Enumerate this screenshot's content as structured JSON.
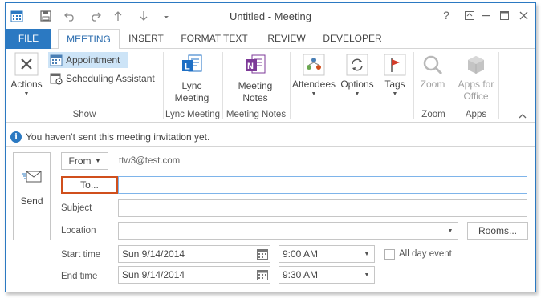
{
  "window": {
    "title": "Untitled - Meeting"
  },
  "tabs": [
    {
      "label": "FILE"
    },
    {
      "label": "MEETING"
    },
    {
      "label": "INSERT"
    },
    {
      "label": "FORMAT TEXT"
    },
    {
      "label": "REVIEW"
    },
    {
      "label": "DEVELOPER"
    }
  ],
  "ribbon": {
    "actions": "Actions",
    "appointment": "Appointment",
    "scheduling": "Scheduling Assistant",
    "show_group": "Show",
    "lync_line1": "Lync",
    "lync_line2": "Meeting",
    "lync_group": "Lync Meeting",
    "notes_line1": "Meeting",
    "notes_line2": "Notes",
    "notes_group": "Meeting Notes",
    "attendees": "Attendees",
    "options": "Options",
    "tags": "Tags",
    "zoom": "Zoom",
    "zoom_group": "Zoom",
    "apps_line1": "Apps for",
    "apps_line2": "Office",
    "apps_group": "Apps"
  },
  "info": "You haven't sent this meeting invitation yet.",
  "form": {
    "send": "Send",
    "from": "From",
    "from_value": "ttw3@test.com",
    "to": "To...",
    "subject": "Subject",
    "location": "Location",
    "rooms": "Rooms...",
    "start_time": "Start time",
    "start_date": "Sun 9/14/2014",
    "start_clock": "9:00 AM",
    "all_day": "All day event",
    "end_time": "End time",
    "end_date": "Sun 9/14/2014",
    "end_clock": "9:30 AM"
  },
  "colors": {
    "accent": "#2b79c2",
    "highlight": "#d04f1c"
  }
}
